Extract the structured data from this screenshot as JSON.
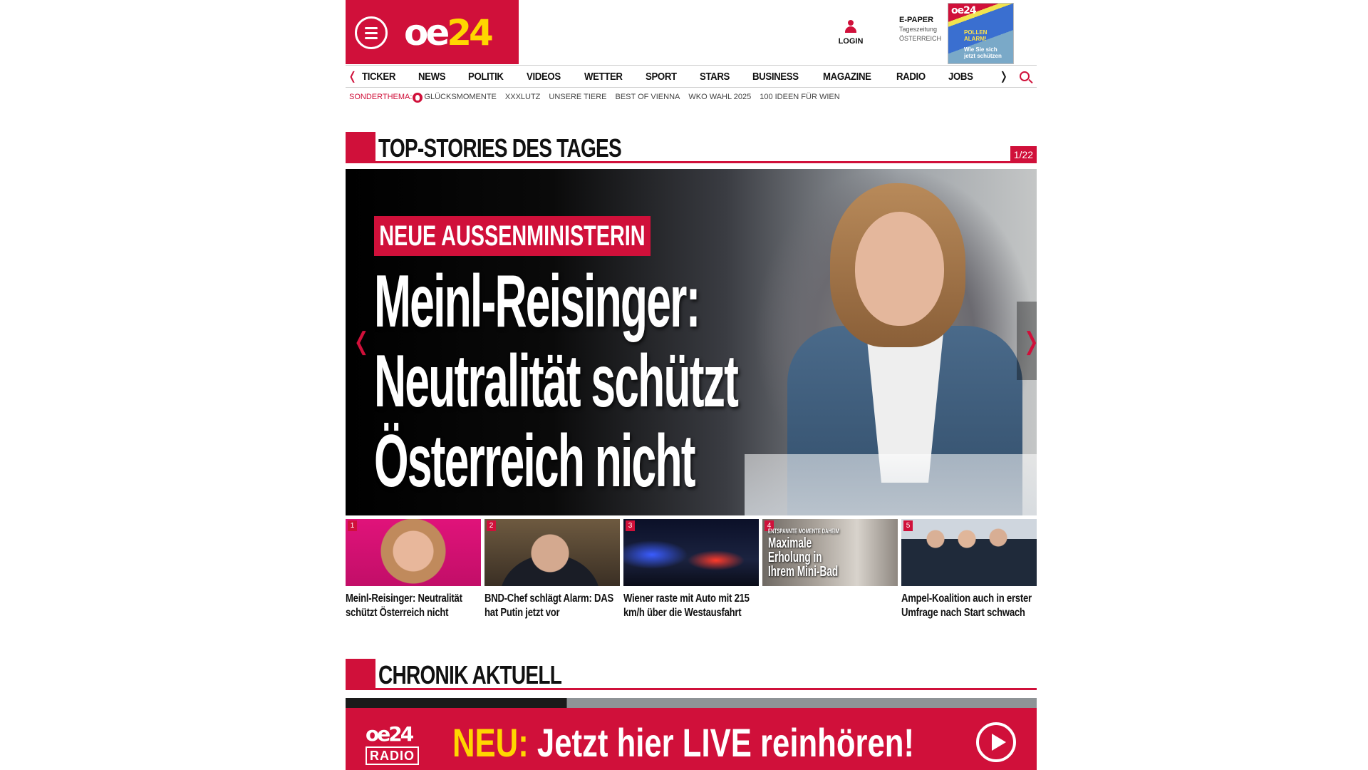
{
  "header": {
    "logo_text": "oe",
    "logo_num": "24",
    "login_label": "LOGIN",
    "epaper": {
      "title": "E-PAPER",
      "line1": "Tageszeitung",
      "line2": "ÖSTERREICH"
    },
    "cover": {
      "title": "oe24",
      "line1": "POLLEN ALARM!",
      "line2": "Wie Sie sich jetzt schützen"
    }
  },
  "nav": {
    "items": [
      "TICKER",
      "NEWS",
      "POLITIK",
      "VIDEOS",
      "WETTER",
      "SPORT",
      "STARS",
      "BUSINESS",
      "MAGAZINE",
      "RADIO",
      "JOBS"
    ]
  },
  "subnav": {
    "lead": "SONDERTHEMA:",
    "items": [
      "GLÜCKSMOMENTE",
      "XXXLUTZ",
      "UNSERE TIERE",
      "BEST OF VIENNA",
      "WKO WAHL 2025",
      "100 IDEEN FÜR WIEN"
    ]
  },
  "top_stories": {
    "title": "TOP-STORIES DES TAGES",
    "counter": "1/22",
    "hero": {
      "kicker": "NEUE AUSSENMINISTERIN",
      "headline": [
        "Meinl-Reisinger:",
        "Neutralität schützt",
        "Österreich nicht"
      ]
    },
    "thumbs": [
      {
        "num": "1",
        "caption": "Meinl-Reisinger: Neutralität schützt Österreich nicht"
      },
      {
        "num": "2",
        "caption": "BND-Chef schlägt Alarm: DAS hat Putin jetzt vor"
      },
      {
        "num": "3",
        "caption": "Wiener raste mit Auto mit 215 km/h über die Westausfahrt"
      },
      {
        "num": "4",
        "caption": "",
        "overlay_small": "ENTSPANNTE MOMENTE DAHEIM",
        "overlay": [
          "Maximale",
          "Erholung in",
          "Ihrem Mini-Bad"
        ]
      },
      {
        "num": "5",
        "caption": "Ampel-Koalition auch in erster Umfrage nach Start schwach"
      }
    ]
  },
  "chronik": {
    "title": "CHRONIK AKTUELL"
  },
  "radio_banner": {
    "logo": "oe24",
    "logo_sub": "RADIO",
    "neu": "NEU:",
    "text": " Jetzt hier LIVE reinhören!"
  }
}
